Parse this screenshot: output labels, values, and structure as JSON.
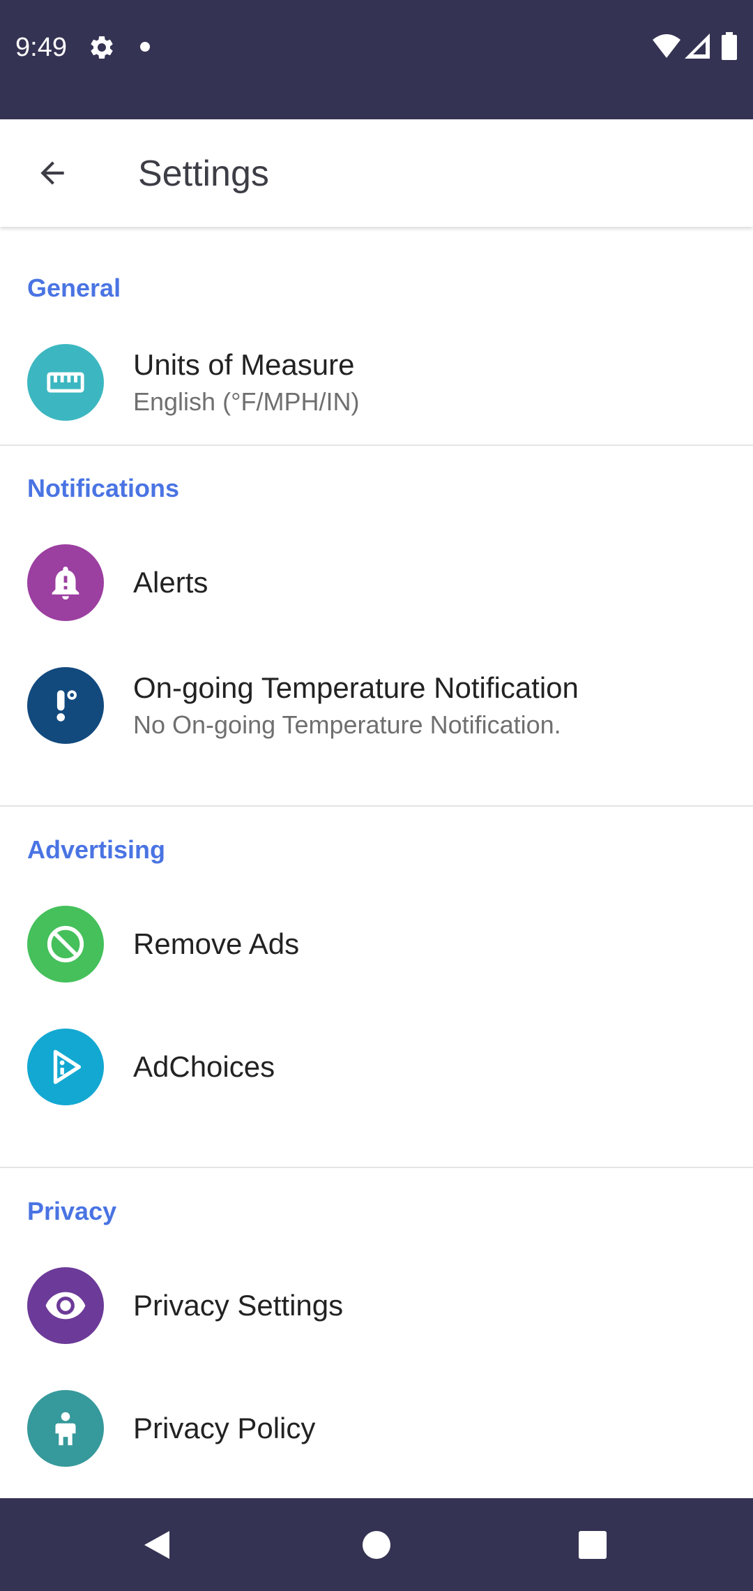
{
  "status_bar": {
    "time": "9:49",
    "icons": [
      "gear-icon",
      "notification-dot",
      "wifi-icon",
      "signal-icon",
      "battery-icon"
    ]
  },
  "app_bar": {
    "back_icon": "arrow-back-icon",
    "title": "Settings"
  },
  "sections": {
    "general": {
      "header": "General",
      "items": [
        {
          "icon": "ruler-icon",
          "color": "#3cb7c1",
          "title": "Units of Measure",
          "subtitle": "English (°F/MPH/IN)"
        }
      ]
    },
    "notifications": {
      "header": "Notifications",
      "items": [
        {
          "icon": "bell-alert-icon",
          "color": "#9b3fa0",
          "title": "Alerts"
        },
        {
          "icon": "thermometer-icon",
          "color": "#124a7e",
          "title": "On-going Temperature Notification",
          "subtitle": "No On-going Temperature Notification."
        }
      ]
    },
    "advertising": {
      "header": "Advertising",
      "items": [
        {
          "icon": "block-icon",
          "color": "#45c05b",
          "title": "Remove Ads"
        },
        {
          "icon": "adchoices-icon",
          "color": "#13a8d1",
          "title": "AdChoices"
        }
      ]
    },
    "privacy": {
      "header": "Privacy",
      "items": [
        {
          "icon": "eye-icon",
          "color": "#6c3a98",
          "title": "Privacy Settings"
        },
        {
          "icon": "person-icon",
          "color": "#36999b",
          "title": "Privacy Policy"
        }
      ]
    }
  },
  "nav_bar": {
    "buttons": [
      "back-triangle-icon",
      "home-circle-icon",
      "recents-square-icon"
    ]
  },
  "colors": {
    "status_bar": "#353353",
    "section_header": "#4a74e3",
    "nav_bar": "#353353"
  }
}
